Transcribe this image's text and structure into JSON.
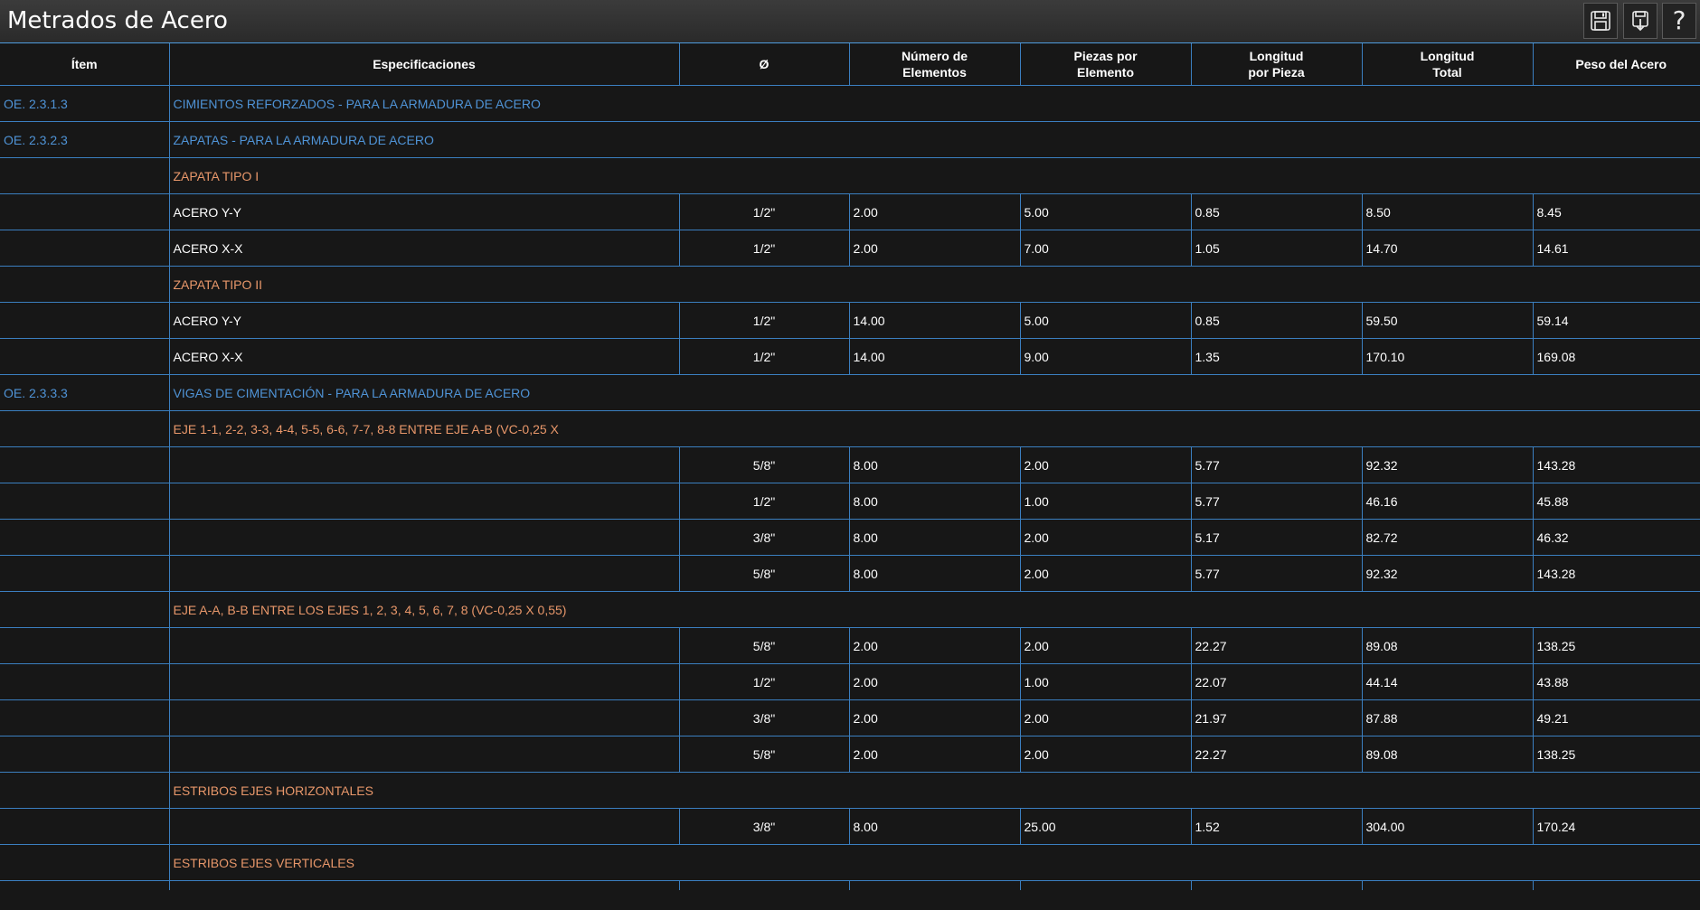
{
  "app": {
    "title": "Metrados de Acero"
  },
  "toolbar": {
    "save_icon": "save-icon",
    "export_icon": "save-export-icon",
    "help_label": "?"
  },
  "table": {
    "headers": {
      "item": "Ítem",
      "spec": "Especificaciones",
      "diameter": "Ø",
      "num_elements_1": "Número de",
      "num_elements_2": "Elementos",
      "pieces_1": "Piezas por",
      "pieces_2": "Elemento",
      "lpp_1": "Longitud",
      "lpp_2": "por Pieza",
      "ltot_1": "Longitud",
      "ltot_2": "Total",
      "weight": "Peso del Acero"
    },
    "rows": [
      {
        "type": "section",
        "item": "OE. 2.3.1.3",
        "title": "CIMIENTOS REFORZADOS - PARA LA ARMADURA DE ACERO"
      },
      {
        "type": "section",
        "item": "OE. 2.3.2.3",
        "title": "ZAPATAS - PARA LA ARMADURA DE ACERO"
      },
      {
        "type": "group",
        "title": "ZAPATA TIPO I"
      },
      {
        "type": "data",
        "spec": "ACERO Y-Y",
        "dia": "1/2\"",
        "num": "2.00",
        "pieces": "5.00",
        "lpp": "0.85",
        "ltot": "8.50",
        "weight": "8.45"
      },
      {
        "type": "data",
        "spec": "ACERO X-X",
        "dia": "1/2\"",
        "num": "2.00",
        "pieces": "7.00",
        "lpp": "1.05",
        "ltot": "14.70",
        "weight": "14.61"
      },
      {
        "type": "group",
        "title": "ZAPATA TIPO II"
      },
      {
        "type": "data",
        "spec": "ACERO Y-Y",
        "dia": "1/2\"",
        "num": "14.00",
        "pieces": "5.00",
        "lpp": "0.85",
        "ltot": "59.50",
        "weight": "59.14"
      },
      {
        "type": "data",
        "spec": "ACERO X-X",
        "dia": "1/2\"",
        "num": "14.00",
        "pieces": "9.00",
        "lpp": "1.35",
        "ltot": "170.10",
        "weight": "169.08"
      },
      {
        "type": "section",
        "item": "OE. 2.3.3.3",
        "title": "VIGAS DE CIMENTACIÓN - PARA LA ARMADURA DE ACERO"
      },
      {
        "type": "group",
        "title": "EJE 1-1, 2-2, 3-3, 4-4, 5-5, 6-6, 7-7, 8-8 ENTRE EJE A-B (VC-0,25 X"
      },
      {
        "type": "data",
        "spec": "",
        "dia": "5/8\"",
        "num": "8.00",
        "pieces": "2.00",
        "lpp": "5.77",
        "ltot": "92.32",
        "weight": "143.28"
      },
      {
        "type": "data",
        "spec": "",
        "dia": "1/2\"",
        "num": "8.00",
        "pieces": "1.00",
        "lpp": "5.77",
        "ltot": "46.16",
        "weight": "45.88"
      },
      {
        "type": "data",
        "spec": "",
        "dia": "3/8\"",
        "num": "8.00",
        "pieces": "2.00",
        "lpp": "5.17",
        "ltot": "82.72",
        "weight": "46.32"
      },
      {
        "type": "data",
        "spec": "",
        "dia": "5/8\"",
        "num": "8.00",
        "pieces": "2.00",
        "lpp": "5.77",
        "ltot": "92.32",
        "weight": "143.28"
      },
      {
        "type": "group",
        "title": "EJE A-A, B-B ENTRE LOS EJES 1, 2, 3, 4, 5, 6, 7, 8 (VC-0,25 X 0,55)"
      },
      {
        "type": "data",
        "spec": "",
        "dia": "5/8\"",
        "num": "2.00",
        "pieces": "2.00",
        "lpp": "22.27",
        "ltot": "89.08",
        "weight": "138.25"
      },
      {
        "type": "data",
        "spec": "",
        "dia": "1/2\"",
        "num": "2.00",
        "pieces": "1.00",
        "lpp": "22.07",
        "ltot": "44.14",
        "weight": "43.88"
      },
      {
        "type": "data",
        "spec": "",
        "dia": "3/8\"",
        "num": "2.00",
        "pieces": "2.00",
        "lpp": "21.97",
        "ltot": "87.88",
        "weight": "49.21"
      },
      {
        "type": "data",
        "spec": "",
        "dia": "5/8\"",
        "num": "2.00",
        "pieces": "2.00",
        "lpp": "22.27",
        "ltot": "89.08",
        "weight": "138.25"
      },
      {
        "type": "group",
        "title": "ESTRIBOS EJES HORIZONTALES"
      },
      {
        "type": "data",
        "spec": "",
        "dia": "3/8\"",
        "num": "8.00",
        "pieces": "25.00",
        "lpp": "1.52",
        "ltot": "304.00",
        "weight": "170.24"
      },
      {
        "type": "group",
        "title": "ESTRIBOS EJES VERTICALES"
      },
      {
        "type": "data",
        "spec": "",
        "dia": "",
        "num": "",
        "pieces": "",
        "lpp": "",
        "ltot": "",
        "weight": ""
      }
    ]
  }
}
